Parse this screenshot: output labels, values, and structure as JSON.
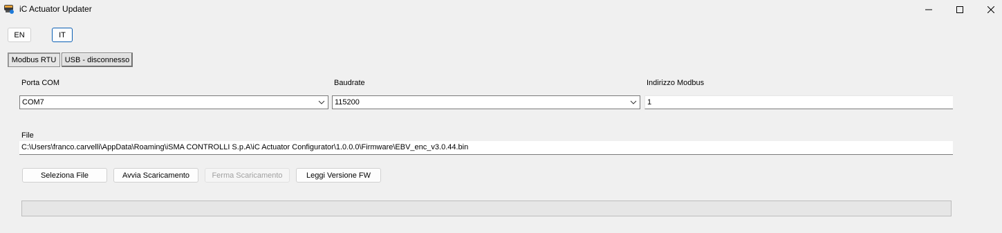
{
  "window": {
    "title": "iC Actuator Updater",
    "icon": "app-icon",
    "controls": [
      "minimize-icon",
      "maximize-icon",
      "close-icon"
    ]
  },
  "language": {
    "en_label": "EN",
    "it_label": "IT",
    "selected": "IT"
  },
  "tabs": [
    {
      "label": "Modbus RTU",
      "active": true
    },
    {
      "label": "USB - disconnesso",
      "active": false
    }
  ],
  "connection": {
    "port_label": "Porta COM",
    "port_value": "COM7",
    "baud_label": "Baudrate",
    "baud_value": "115200",
    "address_label": "Indirizzo Modbus",
    "address_value": "1"
  },
  "file": {
    "label": "File",
    "path": "C:\\Users\\franco.carvelli\\AppData\\Roaming\\iSMA CONTROLLI S.p.A\\iC Actuator Configurator\\1.0.0.0\\Firmware\\EBV_enc_v3.0.44.bin"
  },
  "actions": {
    "select_file": "Seleziona File",
    "start_download": "Avvia Scaricamento",
    "stop_download": "Ferma Scaricamento",
    "read_fw_version": "Leggi Versione FW"
  },
  "progress": {
    "value": 0
  }
}
